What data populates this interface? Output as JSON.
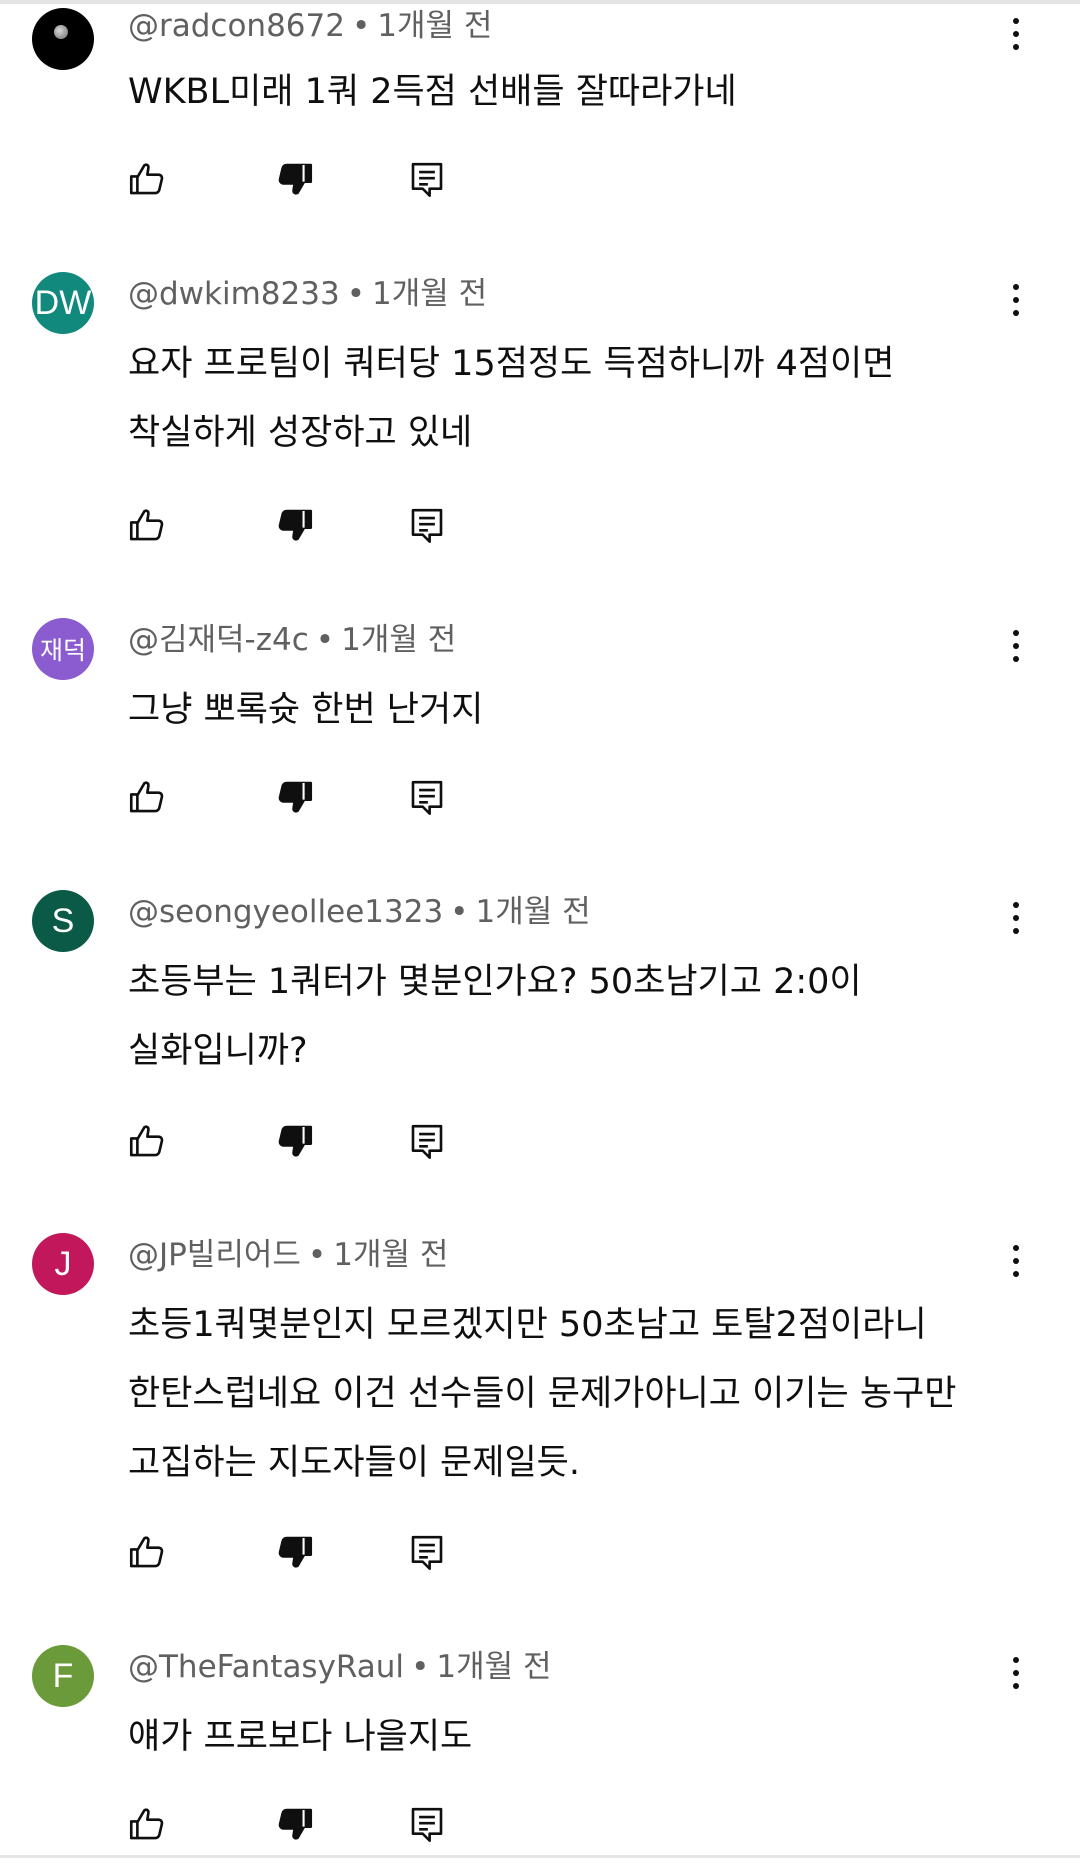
{
  "comments": [
    {
      "handle": "@radcon8672",
      "time": "1개월 전",
      "avatar_text": "",
      "avatar_color": "#000000",
      "text": "WKBL미래 1쿼 2득점 선배들 잘따라가네"
    },
    {
      "handle": "@dwkim8233",
      "time": "1개월 전",
      "avatar_text": "DW",
      "avatar_color": "#12897d",
      "text": "요자 프로팀이 쿼터당 15점정도 득점하니까 4점이면\n착실하게 성장하고 있네"
    },
    {
      "handle": "@김재덕-z4c",
      "time": "1개월 전",
      "avatar_text": "재덕",
      "avatar_color": "#8a5ccf",
      "text": "그냥 뽀록슛 한번 난거지"
    },
    {
      "handle": "@seongyeollee1323",
      "time": "1개월 전",
      "avatar_text": "S",
      "avatar_color": "#0b5a48",
      "text": "초등부는 1쿼터가 몇분인가요? 50초남기고 2:0이\n실화입니까?"
    },
    {
      "handle": "@JP빌리어드",
      "time": "1개월 전",
      "avatar_text": "J",
      "avatar_color": "#c2185b",
      "text": "초등1쿼몇분인지 모르겠지만 50초남고  토탈2점이라니\n한탄스럽네요 이건 선수들이 문제가아니고 이기는 농구만\n고집하는 지도자들이 문제일듯."
    },
    {
      "handle": "@TheFantasyRaul",
      "time": "1개월 전",
      "avatar_text": "F",
      "avatar_color": "#6a9a3a",
      "text": "얘가 프로보다 나을지도"
    }
  ],
  "separator": "•",
  "icons": {
    "like": "thumb-up-icon",
    "dislike": "thumb-down-icon",
    "reply": "reply-comment-icon",
    "more": "more-vert-icon"
  }
}
